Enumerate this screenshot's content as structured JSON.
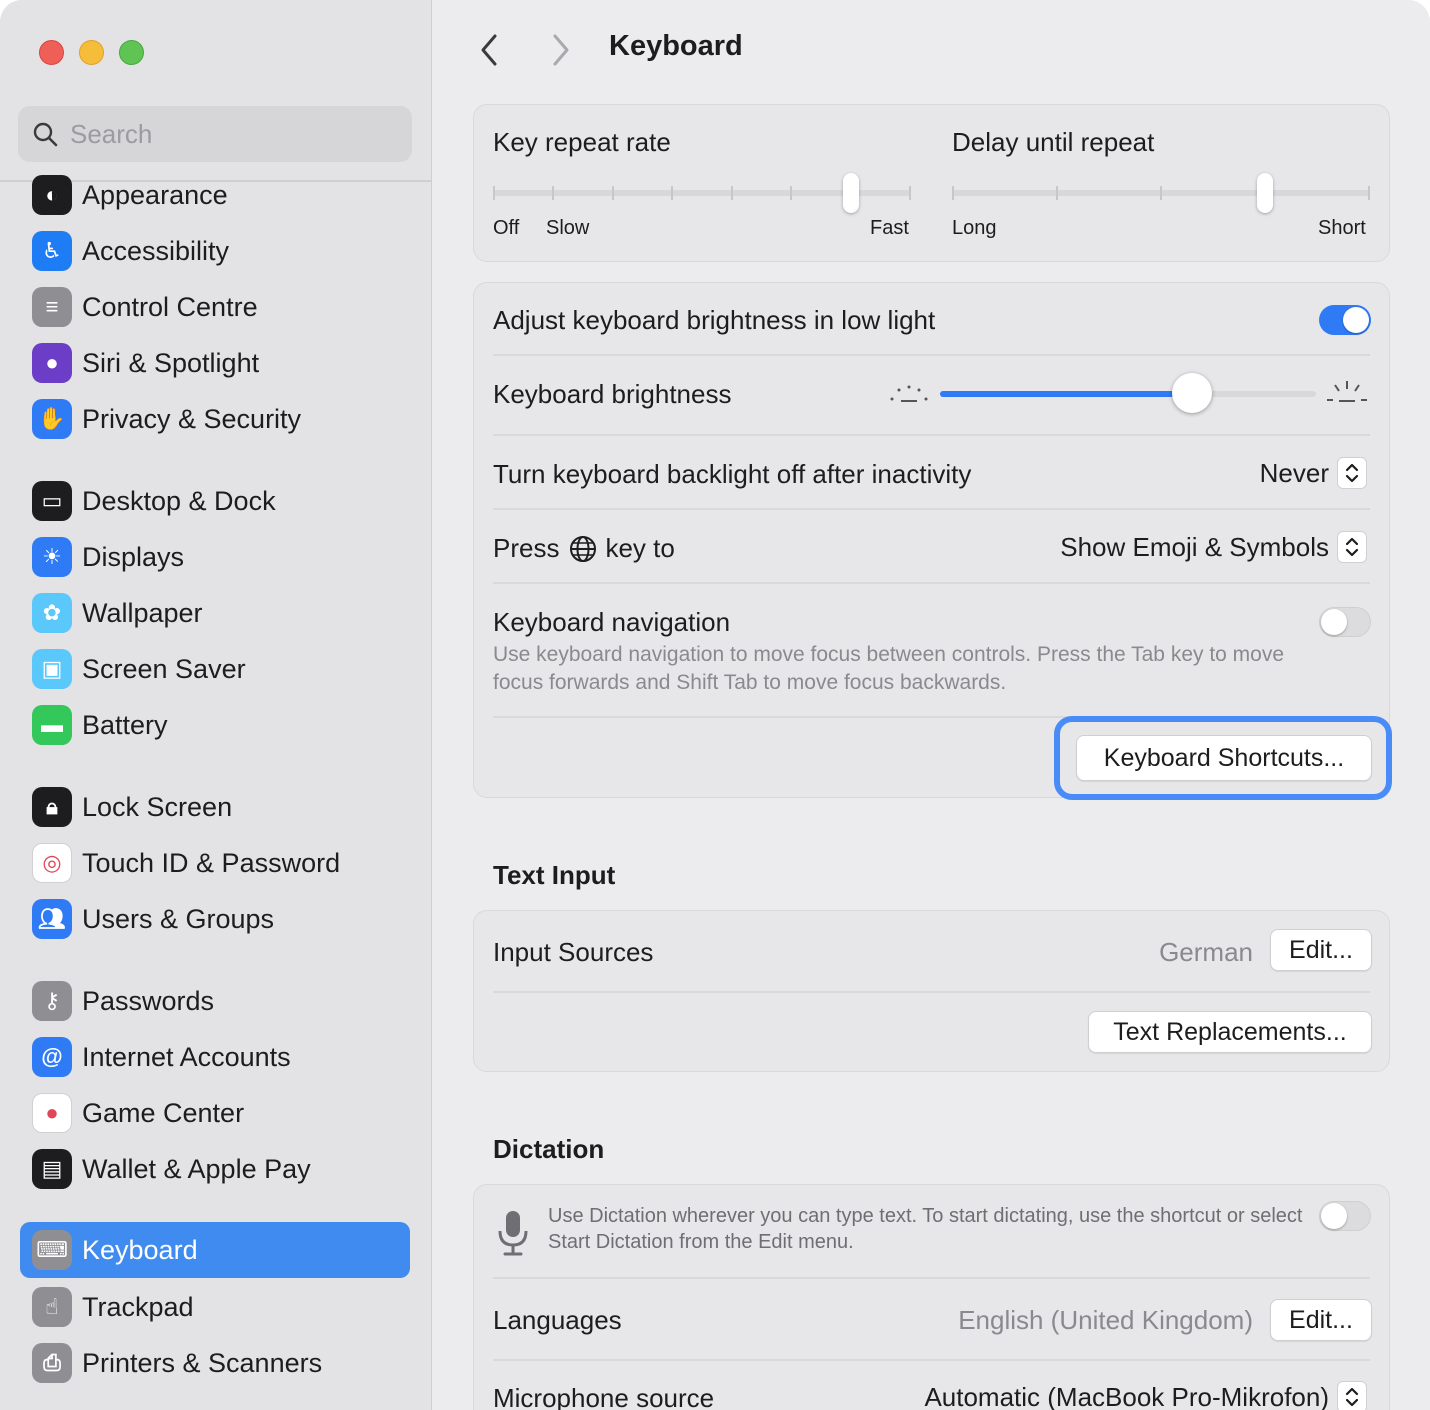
{
  "sidebar": {
    "search_placeholder": "Search",
    "items": [
      {
        "label": "Appearance",
        "icon": "appearance-icon",
        "color": "#1d1d1f"
      },
      {
        "label": "Accessibility",
        "icon": "accessibility-icon",
        "color": "#1e7cf5"
      },
      {
        "label": "Control Centre",
        "icon": "control-centre-icon",
        "color": "#8e8e93"
      },
      {
        "label": "Siri & Spotlight",
        "icon": "siri-icon",
        "color": "#6c3ec8"
      },
      {
        "label": "Privacy & Security",
        "icon": "hand-icon",
        "color": "#2f7bf6"
      },
      {
        "label": "Desktop & Dock",
        "icon": "dock-icon",
        "color": "#1d1d1f"
      },
      {
        "label": "Displays",
        "icon": "sun-icon",
        "color": "#2f7bf6"
      },
      {
        "label": "Wallpaper",
        "icon": "flower-icon",
        "color": "#5ac8fa"
      },
      {
        "label": "Screen Saver",
        "icon": "screensaver-icon",
        "color": "#5ac8fa"
      },
      {
        "label": "Battery",
        "icon": "battery-icon",
        "color": "#34c759"
      },
      {
        "label": "Lock Screen",
        "icon": "lock-icon",
        "color": "#1d1d1f"
      },
      {
        "label": "Touch ID & Password",
        "icon": "fingerprint-icon",
        "color": "#ffffff"
      },
      {
        "label": "Users & Groups",
        "icon": "users-icon",
        "color": "#2f7bf6"
      },
      {
        "label": "Passwords",
        "icon": "key-icon",
        "color": "#8e8e93"
      },
      {
        "label": "Internet Accounts",
        "icon": "at-icon",
        "color": "#2f7bf6"
      },
      {
        "label": "Game Center",
        "icon": "game-center-icon",
        "color": "#ffffff"
      },
      {
        "label": "Wallet & Apple Pay",
        "icon": "wallet-icon",
        "color": "#1d1d1f"
      },
      {
        "label": "Keyboard",
        "icon": "keyboard-icon",
        "color": "#8e8e93"
      },
      {
        "label": "Trackpad",
        "icon": "trackpad-icon",
        "color": "#8e8e93"
      },
      {
        "label": "Printers & Scanners",
        "icon": "printer-icon",
        "color": "#8e8e93"
      }
    ],
    "active_item": "Keyboard"
  },
  "header": {
    "title": "Keyboard"
  },
  "repeat": {
    "key_repeat_label": "Key repeat rate",
    "key_repeat_min": "Off",
    "key_repeat_low": "Slow",
    "key_repeat_max": "Fast",
    "key_repeat_value": 6,
    "key_repeat_steps": 8,
    "delay_label": "Delay until repeat",
    "delay_min": "Long",
    "delay_max": "Short",
    "delay_value": 3,
    "delay_steps": 5
  },
  "brightness": {
    "adjust_label": "Adjust keyboard brightness in low light",
    "adjust_on": true,
    "brightness_label": "Keyboard brightness",
    "brightness_value": 0.67,
    "backlight_label": "Turn keyboard backlight off after inactivity",
    "backlight_value": "Never",
    "press_label_pre": "Press",
    "press_label_post": "key to",
    "press_value": "Show Emoji & Symbols",
    "nav_label": "Keyboard navigation",
    "nav_desc": "Use keyboard navigation to move focus between controls. Press the Tab key to move focus forwards and Shift Tab to move focus backwards.",
    "nav_on": false,
    "shortcuts_button": "Keyboard Shortcuts..."
  },
  "text_input": {
    "heading": "Text Input",
    "input_sources_label": "Input Sources",
    "input_sources_value": "German",
    "edit_label": "Edit...",
    "text_replacements_button": "Text Replacements..."
  },
  "dictation": {
    "heading": "Dictation",
    "desc": "Use Dictation wherever you can type text. To start dictating, use the shortcut or select Start Dictation from the Edit menu.",
    "enabled": false,
    "languages_label": "Languages",
    "languages_value": "English (United Kingdom)",
    "edit_label": "Edit...",
    "mic_label": "Microphone source",
    "mic_value": "Automatic (MacBook Pro-Mikrofon)"
  },
  "colors": {
    "accent": "#2f7bf6",
    "focus_ring": "#4a8cf7"
  }
}
